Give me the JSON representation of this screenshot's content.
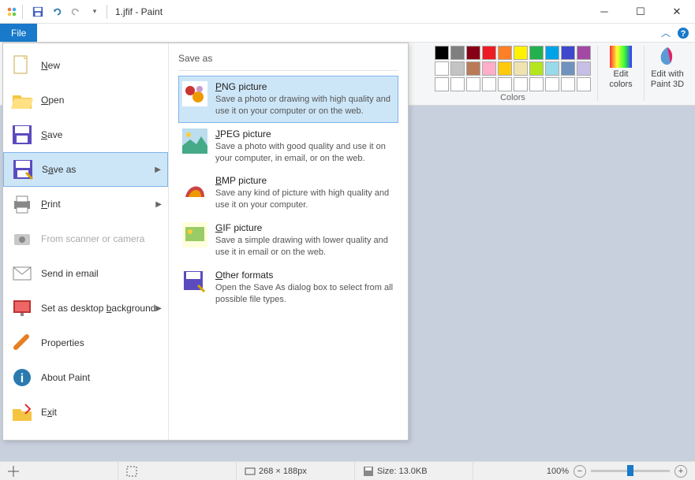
{
  "app": {
    "title": "1.jfif - Paint"
  },
  "file_tab": "File",
  "ribbon": {
    "colors_label": "Colors",
    "edit_colors": "Edit colors",
    "paint3d": "Edit with Paint 3D",
    "swatches_row1": [
      "#000000",
      "#7f7f7f",
      "#880015",
      "#ed1c24",
      "#ff7f27",
      "#fff200",
      "#22b14c",
      "#00a2e8",
      "#3f48cc",
      "#a349a4"
    ],
    "swatches_row2": [
      "#ffffff",
      "#c3c3c3",
      "#b97a57",
      "#ffaec9",
      "#ffc90e",
      "#efe4b0",
      "#b5e61d",
      "#99d9ea",
      "#7092be",
      "#c8bfe7"
    ],
    "swatches_row3": [
      "#ffffff",
      "#ffffff",
      "#ffffff",
      "#ffffff",
      "#ffffff",
      "#ffffff",
      "#ffffff",
      "#ffffff",
      "#ffffff",
      "#ffffff"
    ]
  },
  "file_menu": {
    "items": [
      {
        "label": "New",
        "key": "N"
      },
      {
        "label": "Open",
        "key": "O"
      },
      {
        "label": "Save",
        "key": "S"
      },
      {
        "label": "Save as",
        "key": "a",
        "submenu": true,
        "hl": true
      },
      {
        "label": "Print",
        "key": "P",
        "submenu": true
      },
      {
        "label": "From scanner or camera",
        "disabled": true
      },
      {
        "label": "Send in email"
      },
      {
        "label": "Set as desktop background",
        "key": "b",
        "submenu": true
      },
      {
        "label": "Properties"
      },
      {
        "label": "About Paint"
      },
      {
        "label": "Exit",
        "key": "x"
      }
    ],
    "saveas_header": "Save as",
    "saveas": [
      {
        "title": "PNG picture",
        "key": "P",
        "desc": "Save a photo or drawing with high quality and use it on your computer or on the web.",
        "hl": true
      },
      {
        "title": "JPEG picture",
        "key": "J",
        "desc": "Save a photo with good quality and use it on your computer, in email, or on the web."
      },
      {
        "title": "BMP picture",
        "key": "B",
        "desc": "Save any kind of picture with high quality and use it on your computer."
      },
      {
        "title": "GIF picture",
        "key": "G",
        "desc": "Save a simple drawing with lower quality and use it in email or on the web."
      },
      {
        "title": "Other formats",
        "key": "O",
        "desc": "Open the Save As dialog box to select from all possible file types."
      }
    ]
  },
  "status": {
    "dimensions": "268 × 188px",
    "size": "Size: 13.0KB",
    "zoom": "100%"
  }
}
